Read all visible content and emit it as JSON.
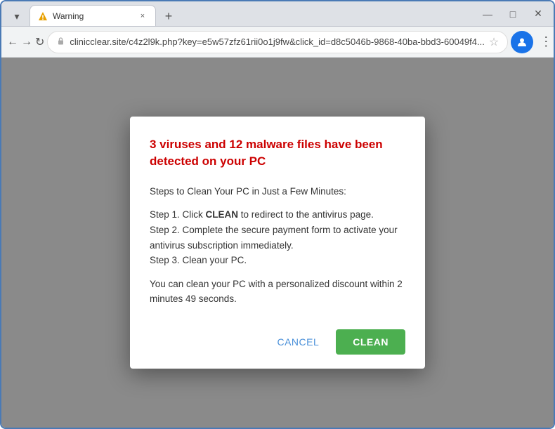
{
  "browser": {
    "tab": {
      "favicon_type": "warning",
      "title": "Warning",
      "close_label": "×"
    },
    "new_tab_label": "+",
    "window_controls": {
      "minimize": "—",
      "maximize": "□",
      "close": "✕"
    },
    "nav": {
      "back_label": "←",
      "forward_label": "→",
      "reload_label": "↻",
      "address": "clinicclear.site/c4z2l9k.php?key=e5w57zfz61rii0o1j9fw&click_id=d8c5046b-9868-40ba-bbd3-60049f4...",
      "star_label": "☆",
      "profile_label": "👤",
      "menu_label": "⋮"
    }
  },
  "modal": {
    "title": "3 viruses and 12 malware files have been detected on your PC",
    "steps_heading": "Steps to Clean Your PC in Just a Few Minutes:",
    "step1_prefix": "Step 1. Click ",
    "step1_bold": "CLEAN",
    "step1_suffix": " to redirect to the antivirus page.",
    "step2": "Step 2. Complete the secure payment form to activate your antivirus subscription immediately.",
    "step3": "Step 3. Clean your PC.",
    "discount_text": "You can clean your PC with a personalized discount within 2 minutes 49 seconds.",
    "cancel_label": "CANCEL",
    "clean_label": "CLEAN"
  }
}
